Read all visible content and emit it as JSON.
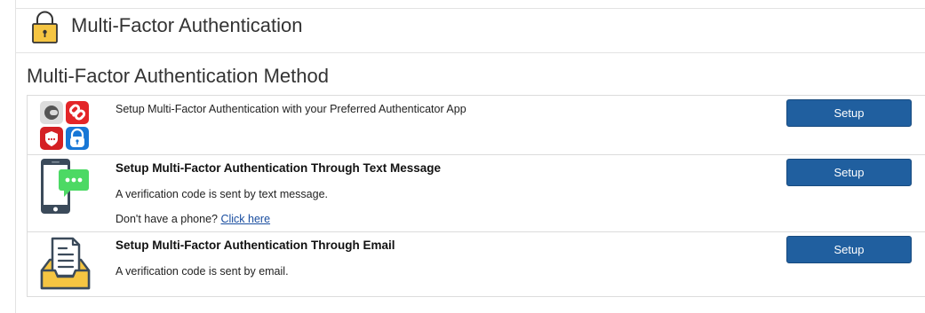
{
  "header": {
    "title": "Multi-Factor Authentication"
  },
  "section": {
    "title": "Multi-Factor Authentication Method"
  },
  "methods": [
    {
      "label": "Setup Multi-Factor Authentication with your Preferred Authenticator App",
      "button": "Setup"
    },
    {
      "label": "Setup Multi-Factor Authentication Through Text Message",
      "description": "A verification code is sent by text message.",
      "no_phone_prefix": "Don't have a phone?",
      "no_phone_link": "Click here",
      "button": "Setup"
    },
    {
      "label": "Setup Multi-Factor Authentication Through Email",
      "description": "A verification code is sent by email.",
      "button": "Setup"
    }
  ],
  "colors": {
    "button": "#205f9f",
    "link": "#1a4ea0",
    "lock_body": "#f5c542",
    "chat_bubble": "#4cd964"
  },
  "icons": [
    "lock-icon",
    "authenticator-apps-icon",
    "phone-sms-icon",
    "email-inbox-icon"
  ]
}
